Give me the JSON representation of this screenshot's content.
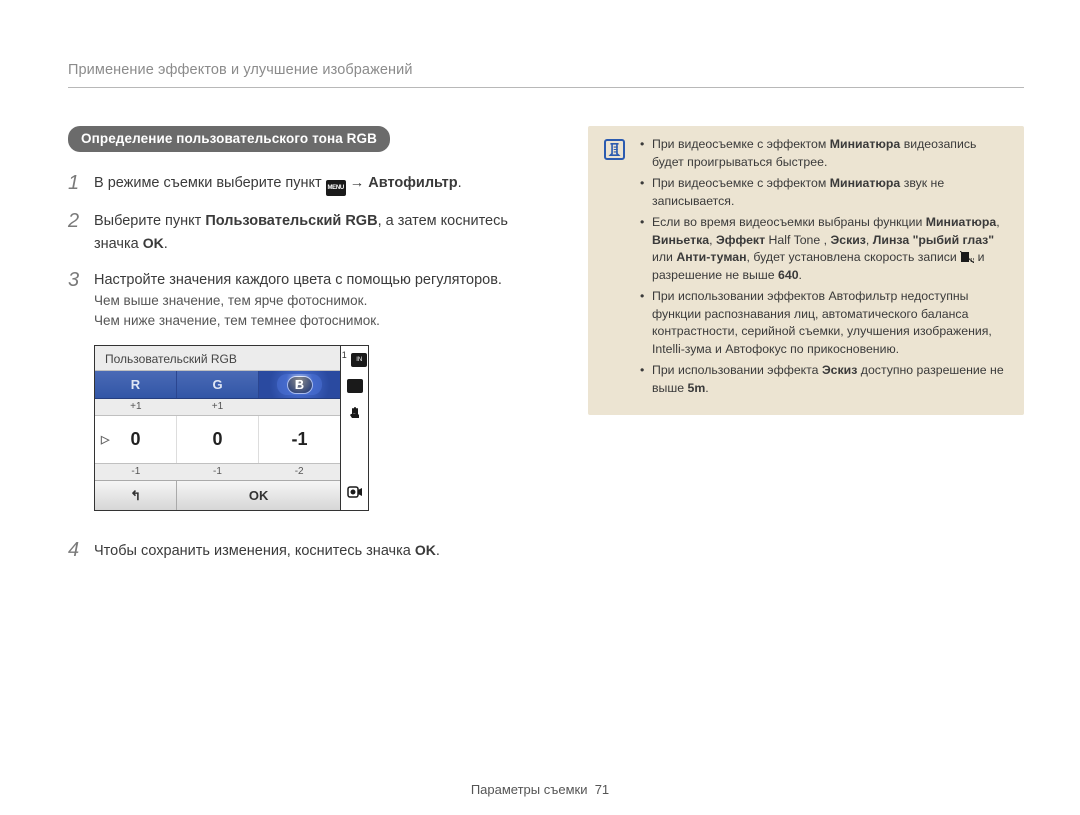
{
  "breadcrumb": "Применение эффектов и улучшение изображений",
  "badge": "Определение пользовательского тона RGB",
  "steps": {
    "s1": {
      "num": "1",
      "pre": "В режиме съемки выберите пункт ",
      "menu_icon": "MENU",
      "post1": " → ",
      "bold": "Автофильтр",
      "post2": "."
    },
    "s2": {
      "num": "2",
      "pre": "Выберите пункт ",
      "bold": "Пользовательский RGB",
      "mid": ", а затем коснитесь значка ",
      "ok": "OK",
      "post": "."
    },
    "s3": {
      "num": "3",
      "text": "Настройте значения каждого цвета с помощью регуляторов.",
      "sub1": "Чем выше значение, тем ярче фотоснимок.",
      "sub2": "Чем ниже значение, тем темнее фотоснимок."
    },
    "s4": {
      "num": "4",
      "pre": "Чтобы сохранить изменения, коснитесь значка ",
      "ok": "OK",
      "post": "."
    }
  },
  "camera": {
    "title": "Пользовательский RGB",
    "tabs": {
      "r": "R",
      "g": "G",
      "b": "B"
    },
    "plus": {
      "a": "+1",
      "b": "+1",
      "c": ""
    },
    "vals": {
      "a": "0",
      "b": "0",
      "c": "-1"
    },
    "minus": {
      "a": "-1",
      "b": "-1",
      "c": "-2"
    },
    "back": "↰",
    "ok": "OK",
    "side_n": "1",
    "side_in": "IN"
  },
  "note": {
    "items": [
      {
        "pre": "При видеосъемке с эффектом ",
        "b1": "Миниатюра",
        "post": " видеозапись будет проигрываться быстрее."
      },
      {
        "pre": "При видеосъемке с эффектом ",
        "b1": "Миниатюра",
        "post": " звук не записывается."
      },
      {
        "pre": "Если во время видеосъемки выбраны функции ",
        "b1": "Миниатюра",
        "sep1": ", ",
        "b2": "Виньетка",
        "sep2": ", ",
        "b3": "Эффект",
        "half": " Half Tone ",
        "sep3": ", ",
        "b4": "Эскиз",
        "sep4": ", ",
        "b5": "Линза \"рыбий глаз\"",
        "post_pre": " или ",
        "b6": "Анти-туман",
        "post": ", будет установлена скорость записи ",
        "res": " и разрешение не выше ",
        "b_res": "640",
        "dot": "."
      },
      {
        "text": "При использовании эффектов Автофильтр недоступны функции распознавания лиц, автоматического баланса контрастности, серийной съемки, улучшения изображения, Intelli-зума и Автофокус по прикосновению."
      },
      {
        "pre": "При использовании эффекта ",
        "b1": "Эскиз",
        "post": " доступно разрешение не выше ",
        "b_res": "5m",
        "dot": "."
      }
    ]
  },
  "footer": {
    "section": "Параметры съемки",
    "page": "71"
  }
}
